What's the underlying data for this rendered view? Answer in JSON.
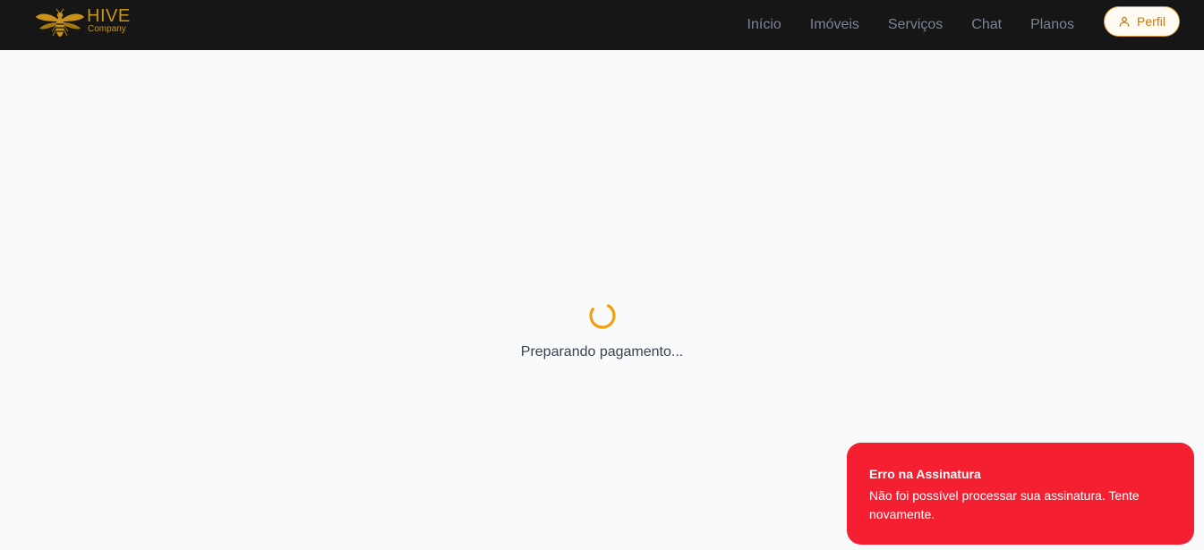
{
  "brand": {
    "name": "HIVE",
    "tagline": "Company",
    "color": "#c9921a"
  },
  "nav": {
    "items": [
      {
        "label": "Início"
      },
      {
        "label": "Imóveis"
      },
      {
        "label": "Serviços"
      },
      {
        "label": "Chat"
      },
      {
        "label": "Planos"
      }
    ],
    "profile_label": "Perfil",
    "profile_icon": "user-icon"
  },
  "main": {
    "loading_text": "Preparando pagamento...",
    "spinner_color": "#f59e0b"
  },
  "toast": {
    "title": "Erro na Assinatura",
    "description": "Não foi possível processar sua assinatura. Tente novamente.",
    "color": "#f42032"
  }
}
